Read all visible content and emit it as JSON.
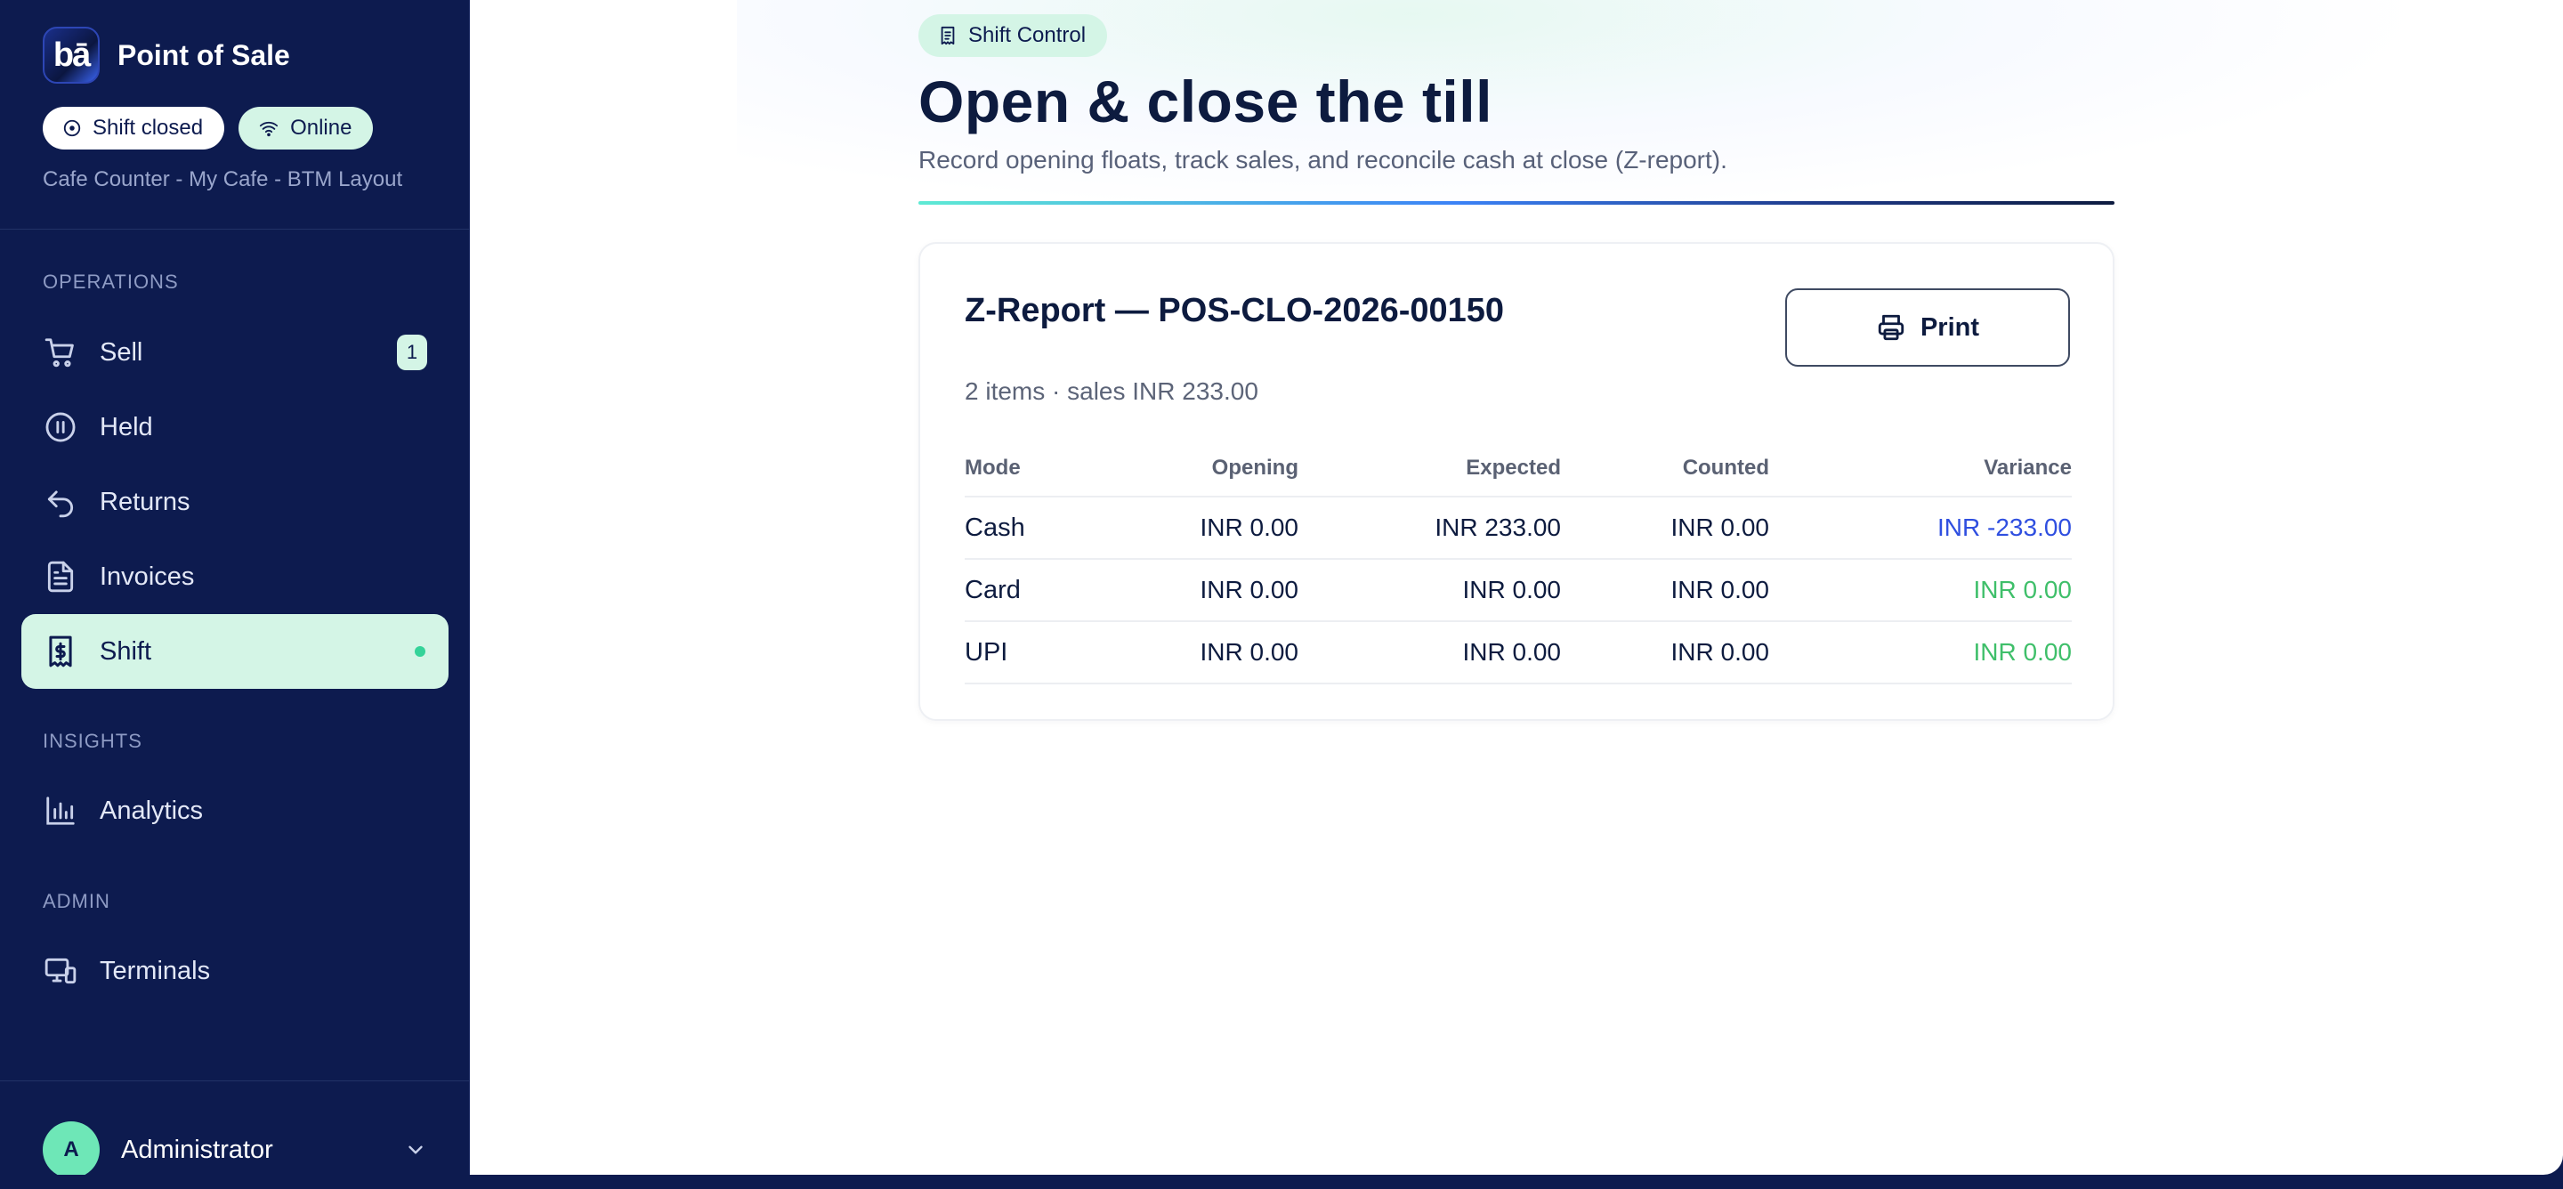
{
  "app": {
    "title": "Point of Sale",
    "logo_text": "bā",
    "status_shift": "Shift closed",
    "status_network": "Online",
    "location": "Cafe Counter - My Cafe - BTM Layout"
  },
  "sidebar": {
    "sections": [
      {
        "label": "OPERATIONS"
      },
      {
        "label": "INSIGHTS"
      },
      {
        "label": "ADMIN"
      }
    ],
    "items": [
      {
        "label": "Sell",
        "icon": "cart-icon",
        "badge": "1"
      },
      {
        "label": "Held",
        "icon": "pause-icon"
      },
      {
        "label": "Returns",
        "icon": "return-icon"
      },
      {
        "label": "Invoices",
        "icon": "document-icon"
      },
      {
        "label": "Shift",
        "icon": "receipt-dollar-icon",
        "active": true
      },
      {
        "label": "Analytics",
        "icon": "bar-chart-icon"
      },
      {
        "label": "Terminals",
        "icon": "monitor-icon"
      }
    ],
    "user": {
      "initial": "A",
      "name": "Administrator"
    }
  },
  "main": {
    "chip": "Shift Control",
    "title": "Open & close the till",
    "subtitle": "Record opening floats, track sales, and reconcile cash at close (Z-report).",
    "report": {
      "title": "Z-Report — POS-CLO-2026-00150",
      "meta": "2 items · sales INR 233.00",
      "print_label": "Print",
      "columns": [
        "Mode",
        "Opening",
        "Expected",
        "Counted",
        "Variance"
      ],
      "rows": [
        {
          "mode": "Cash",
          "opening": "INR 0.00",
          "expected": "INR 233.00",
          "counted": "INR 0.00",
          "variance": "INR -233.00"
        },
        {
          "mode": "Card",
          "opening": "INR 0.00",
          "expected": "INR 0.00",
          "counted": "INR 0.00",
          "variance": "INR 0.00"
        },
        {
          "mode": "UPI",
          "opening": "INR 0.00",
          "expected": "INR 0.00",
          "counted": "INR 0.00",
          "variance": "INR 0.00"
        }
      ]
    }
  },
  "colors": {
    "sidebar_bg": "#0d1b4f",
    "accent_mint": "#d4f5e6",
    "variance_negative": "#2f4fe0",
    "variance_zero": "#3fbf6a"
  }
}
